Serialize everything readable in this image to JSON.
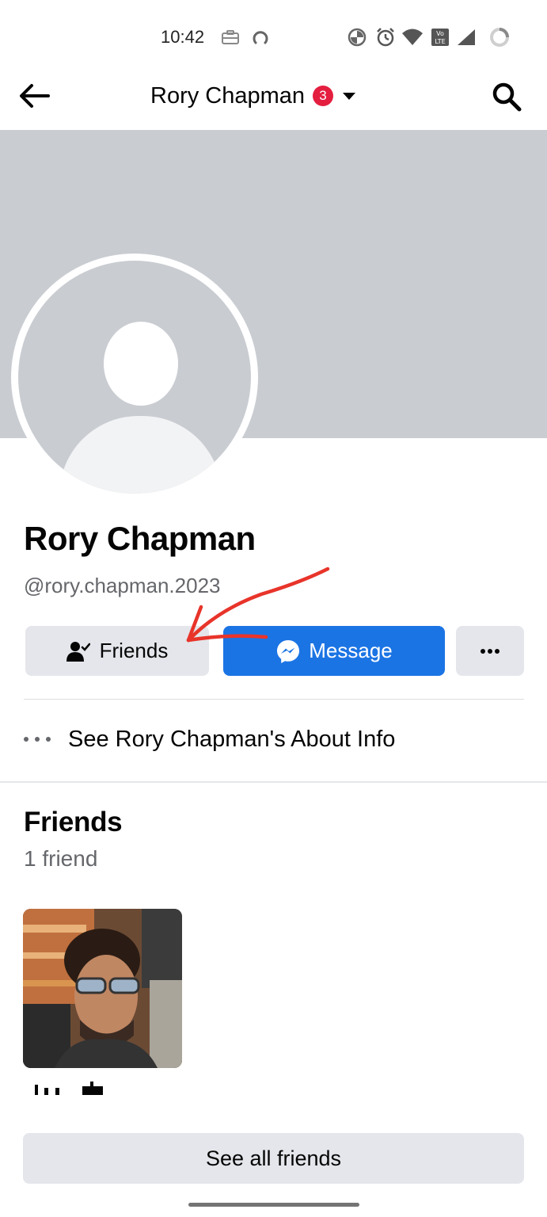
{
  "status_bar": {
    "time": "10:42"
  },
  "nav": {
    "title": "Rory Chapman",
    "badge_count": "3"
  },
  "profile": {
    "name": "Rory Chapman",
    "handle": "@rory.chapman.2023"
  },
  "actions": {
    "friends_label": "Friends",
    "message_label": "Message"
  },
  "about": {
    "label": "See Rory Chapman's About Info"
  },
  "friends_section": {
    "title": "Friends",
    "count_label": "1 friend",
    "see_all_label": "See all friends"
  },
  "colors": {
    "brand_blue": "#1b74e4",
    "badge_red": "#e41e3f",
    "button_gray": "#e4e6eb",
    "cover_gray": "#c9ccd1",
    "annotation_red": "#e8342a"
  }
}
